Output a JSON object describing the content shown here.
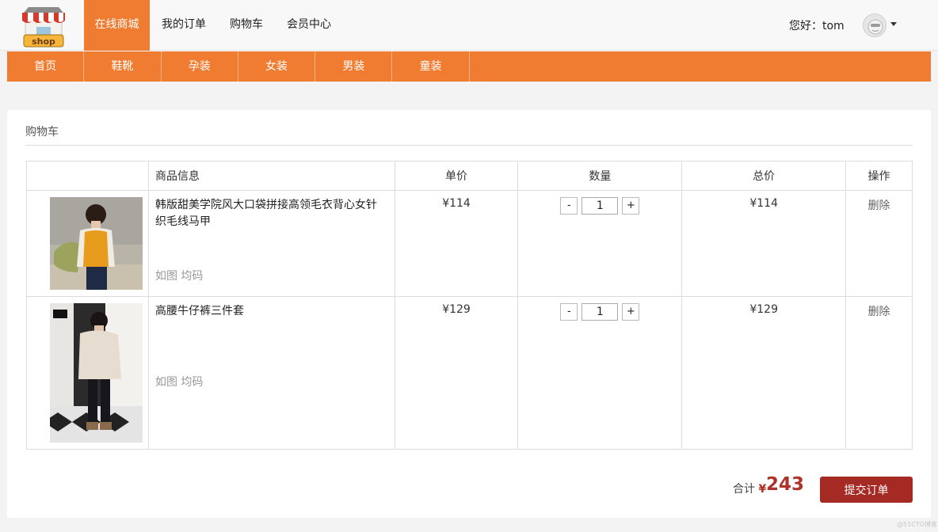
{
  "header": {
    "logo_text": "shop",
    "nav": [
      {
        "label": "在线商城",
        "active": true
      },
      {
        "label": "我的订单",
        "active": false
      },
      {
        "label": "购物车",
        "active": false
      },
      {
        "label": "会员中心",
        "active": false
      }
    ],
    "greeting": "您好：tom",
    "accent_color": "#f07c32"
  },
  "categories": [
    "首页",
    "鞋靴",
    "孕装",
    "女装",
    "男装",
    "童装"
  ],
  "cart": {
    "title": "购物车",
    "columns": [
      "",
      "商品信息",
      "单价",
      "数量",
      "总价",
      "操作"
    ],
    "items": [
      {
        "name": "韩版甜美学院风大口袋拼接高领毛衣背心女针织毛线马甲",
        "spec": "如图 均码",
        "price": "¥114",
        "quantity": "1",
        "total": "¥114",
        "action": "删除",
        "minus": "-",
        "plus": "+"
      },
      {
        "name": "高腰牛仔裤三件套",
        "spec": "如图 均码",
        "price": "¥129",
        "quantity": "1",
        "total": "¥129",
        "action": "删除",
        "minus": "-",
        "plus": "+"
      }
    ],
    "total_label": "合计",
    "currency_symbol": "¥",
    "total_value": "243",
    "submit_label": "提交订单",
    "submit_color": "#a52a24"
  },
  "watermark": "@51CTO博客"
}
